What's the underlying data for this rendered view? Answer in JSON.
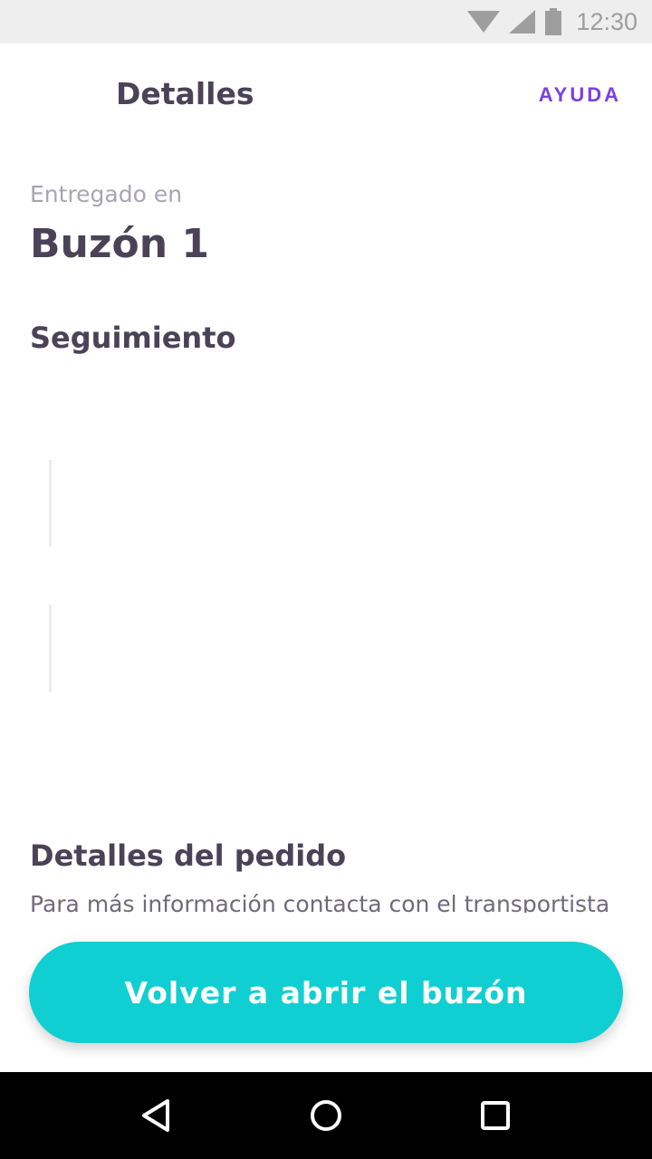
{
  "status_bar": {
    "time": "12:30",
    "icons": [
      "wifi-icon",
      "cell-signal-icon",
      "battery-icon"
    ]
  },
  "app_bar": {
    "title": "Detalles",
    "help_label": "AYUDA",
    "accent_color": "#7b3fe4"
  },
  "delivery": {
    "label": "Entregado en",
    "location": "Buzón 1"
  },
  "tracking": {
    "title": "Seguimiento"
  },
  "order": {
    "title": "Detalles del pedido",
    "text": "Para más información contacta con el transportista"
  },
  "primary_action": {
    "label": "Volver a abrir el buzón",
    "color": "#10cfd2"
  },
  "nav": {
    "icons": [
      "back-icon",
      "home-icon",
      "recents-icon"
    ]
  }
}
